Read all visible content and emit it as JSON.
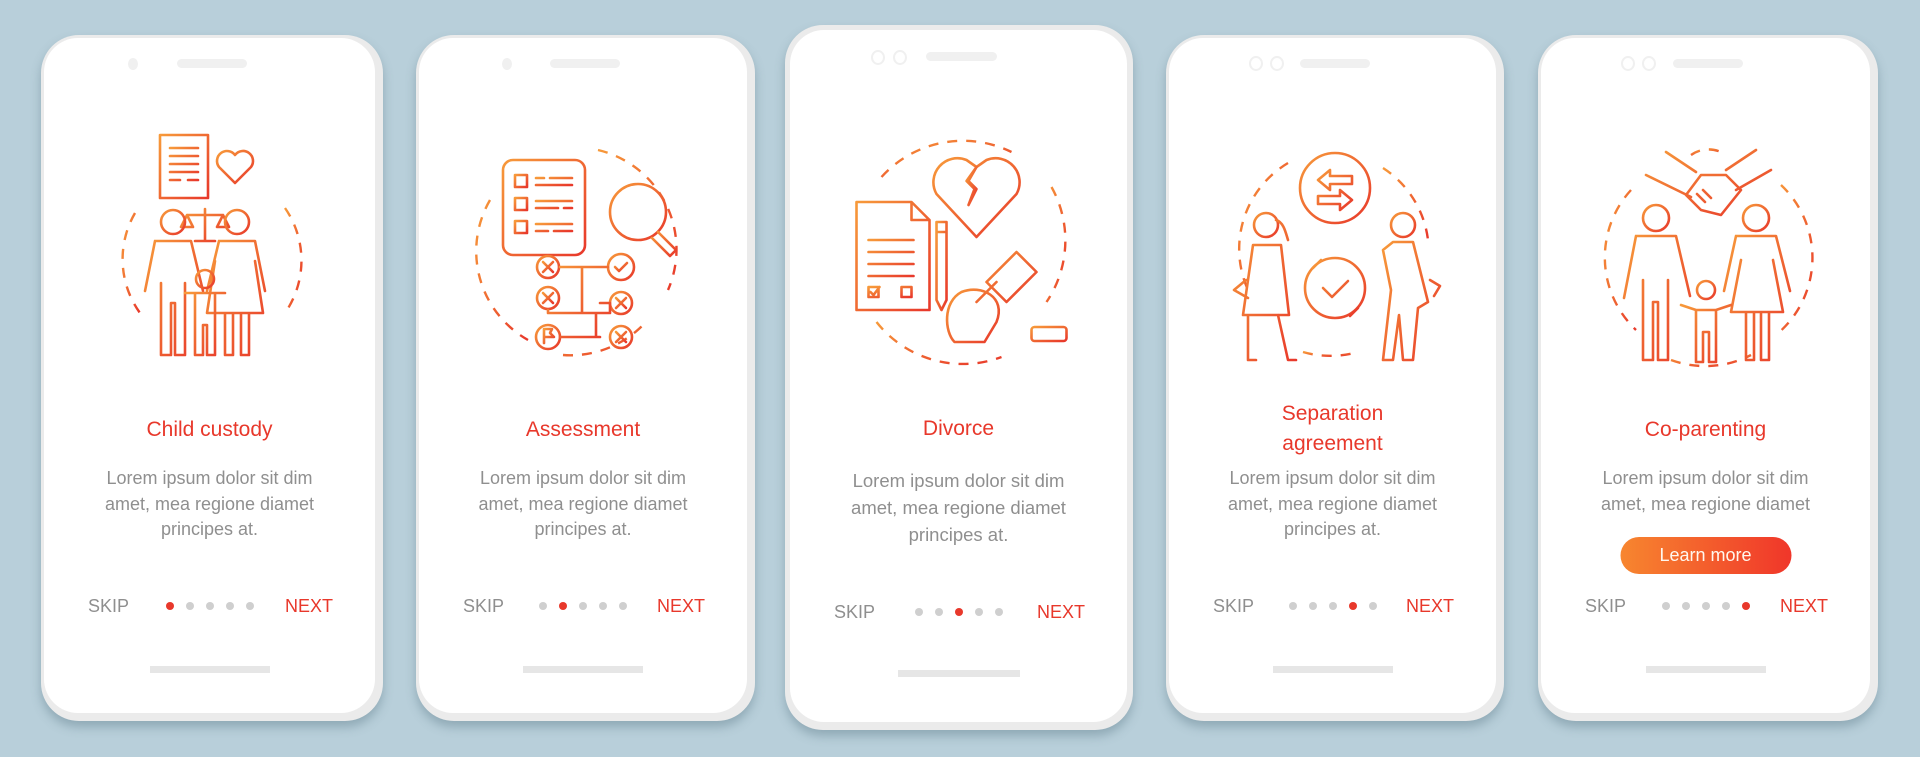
{
  "theme": {
    "accent": "#e8382b",
    "gradient_start": "#f7862f",
    "gradient_end": "#f0362a",
    "background": "#b8cfda",
    "body_text": "#8f8f8f",
    "inactive_dot": "#cfcfcf"
  },
  "screens": [
    {
      "illustration": "child-custody-illustration",
      "title": "Child custody",
      "body": [
        "Lorem ipsum dolor sit dim",
        "amet, mea regione diamet",
        "principes at."
      ],
      "skip_label": "SKIP",
      "next_label": "NEXT",
      "active_page": 1,
      "total_pages": 5
    },
    {
      "illustration": "assessment-illustration",
      "title": "Assessment",
      "body": [
        "Lorem ipsum dolor sit dim",
        "amet, mea regione diamet",
        "principes at."
      ],
      "skip_label": "SKIP",
      "next_label": "NEXT",
      "active_page": 2,
      "total_pages": 5
    },
    {
      "illustration": "divorce-illustration",
      "title": "Divorce",
      "body": [
        "Lorem ipsum dolor sit dim",
        "amet, mea regione diamet",
        "principes at."
      ],
      "skip_label": "SKIP",
      "next_label": "NEXT",
      "active_page": 3,
      "total_pages": 5
    },
    {
      "illustration": "separation-agreement-illustration",
      "title_lines": [
        "Separation",
        "agreement"
      ],
      "body": [
        "Lorem ipsum dolor sit dim",
        "amet, mea regione diamet",
        "principes at."
      ],
      "skip_label": "SKIP",
      "next_label": "NEXT",
      "active_page": 4,
      "total_pages": 5
    },
    {
      "illustration": "co-parenting-illustration",
      "title": "Co-parenting",
      "body": [
        "Lorem ipsum dolor sit dim",
        "amet, mea regione diamet"
      ],
      "button_label": "Learn more",
      "skip_label": "SKIP",
      "next_label": "NEXT",
      "active_page": 5,
      "total_pages": 5
    }
  ]
}
